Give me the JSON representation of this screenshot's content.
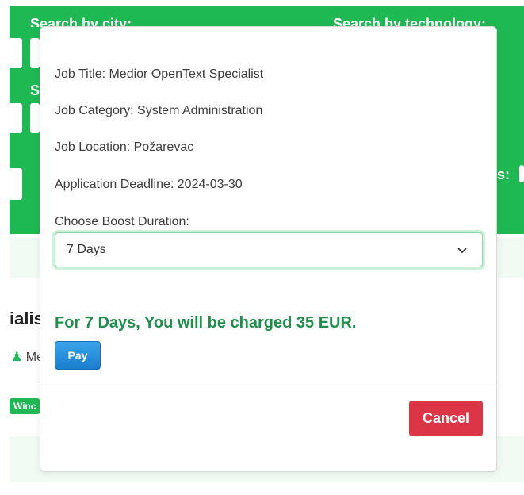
{
  "background": {
    "search_city_label": "Search by city:",
    "search_tech_label": "Search by technology:",
    "s_label": "S",
    "s_label_2": "S",
    "colon_label": "s:",
    "job_title_fragment": "ialis",
    "meta_fragment": "Me",
    "tag_fragment": "Winc"
  },
  "modal": {
    "job_title": "Job Title: Medior OpenText Specialist",
    "job_category": "Job Category: System Administration",
    "job_location": "Job Location: Požarevac",
    "deadline": "Application Deadline: 2024-03-30",
    "boost_label": "Choose Boost Duration:",
    "boost_selected": "7 Days",
    "charge_text": "For 7 Days, You will be charged 35 EUR.",
    "pay_label": "Pay",
    "cancel_label": "Cancel"
  },
  "colors": {
    "brand_green": "#1fb954",
    "charge_green": "#1e8f4a",
    "pay_blue": "#1a7fcf",
    "cancel_red": "#dc3545"
  }
}
